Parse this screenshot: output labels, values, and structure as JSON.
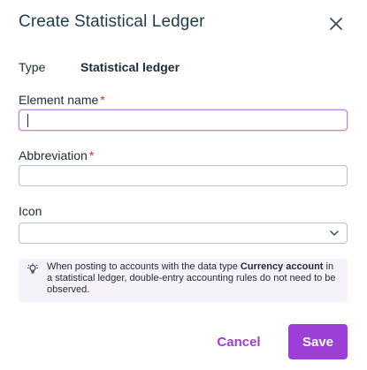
{
  "dialog": {
    "title": "Create Statistical Ledger",
    "close_icon": "close-icon"
  },
  "type_row": {
    "label": "Type",
    "value": "Statistical ledger"
  },
  "fields": {
    "element_name": {
      "label": "Element name",
      "required_mark": "*",
      "value": ""
    },
    "abbreviation": {
      "label": "Abbreviation",
      "required_mark": "*",
      "value": ""
    },
    "icon": {
      "label": "Icon",
      "value": "",
      "chevron_icon": "chevron-down-icon"
    }
  },
  "hint": {
    "icon": "lightbulb-icon",
    "text_before": "When posting to accounts with the data type ",
    "text_bold": "Currency account",
    "text_after": " in a statistical ledger, double-entry accounting rules do not need to be observed."
  },
  "buttons": {
    "cancel": "Cancel",
    "save": "Save"
  },
  "colors": {
    "accent": "#9b3fd6",
    "required": "#d4351c",
    "hint_background": "#f5f2f9",
    "title": "#1e3a4c"
  }
}
